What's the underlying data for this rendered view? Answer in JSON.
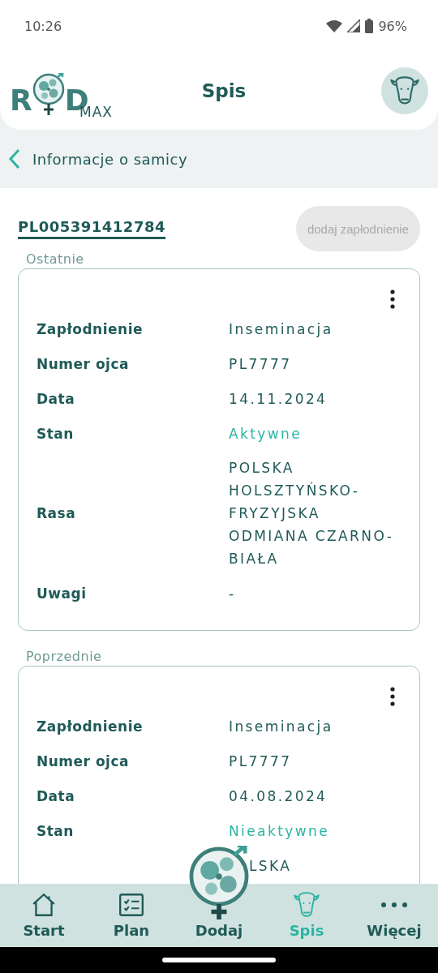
{
  "status_bar": {
    "time": "10:26",
    "battery": "96%"
  },
  "header": {
    "logo": {
      "left": "R",
      "right": "D",
      "sub": "MAX"
    },
    "title": "Spis"
  },
  "back": {
    "label": "Informacje o samicy"
  },
  "animal": {
    "id": "PL005391412784",
    "button": {
      "label": "dodaj zapłodnienie",
      "disabled": true
    }
  },
  "sections": [
    {
      "title": "Ostatnie",
      "rows": [
        {
          "kind": "field",
          "label": "Zapłodnienie",
          "value": "Inseminacja"
        },
        {
          "kind": "field",
          "label": "Numer ojca",
          "value": "PL7777"
        },
        {
          "kind": "field",
          "label": "Data",
          "value": "14.11.2024"
        },
        {
          "kind": "status",
          "label": "Stan",
          "value": "Aktywne"
        },
        {
          "kind": "field",
          "label": "Rasa",
          "value": "POLSKA HOLSZTYŃSKO-FRYZYJSKA ODMIANA CZARNO-BIAŁA"
        },
        {
          "kind": "field",
          "label": "Uwagi",
          "value": "-"
        }
      ]
    },
    {
      "title": "Poprzednie",
      "rows": [
        {
          "kind": "field",
          "label": "Zapłodnienie",
          "value": "Inseminacja"
        },
        {
          "kind": "field",
          "label": "Numer ojca",
          "value": "PL7777"
        },
        {
          "kind": "field",
          "label": "Data",
          "value": "04.08.2024"
        },
        {
          "kind": "status",
          "label": "Stan",
          "value": "Nieaktywne"
        },
        {
          "kind": "partial",
          "value": "LSKA"
        }
      ]
    }
  ],
  "nav": [
    {
      "label": "Start",
      "kind": "home",
      "selected": false
    },
    {
      "label": "Plan",
      "kind": "plan",
      "selected": false
    },
    {
      "label": "Dodaj",
      "kind": "add",
      "selected": false
    },
    {
      "label": "Spis",
      "kind": "cow",
      "selected": true
    },
    {
      "label": "Więcej",
      "kind": "more",
      "selected": false
    }
  ]
}
